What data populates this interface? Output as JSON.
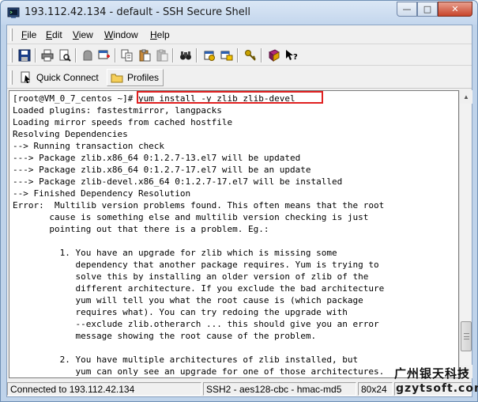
{
  "window": {
    "title": "193.112.42.134 - default - SSH Secure Shell",
    "minimize_label": "—",
    "maximize_label": "□",
    "close_label": "✕"
  },
  "menu": {
    "items": [
      {
        "label": "File",
        "accel": "F",
        "rest": "ile"
      },
      {
        "label": "Edit",
        "accel": "E",
        "rest": "dit"
      },
      {
        "label": "View",
        "accel": "V",
        "rest": "iew"
      },
      {
        "label": "Window",
        "accel": "W",
        "rest": "indow"
      },
      {
        "label": "Help",
        "accel": "H",
        "rest": "elp"
      }
    ]
  },
  "toolbar": {
    "icons": [
      "save-icon",
      "print-icon",
      "print-preview-icon",
      "disconnect-icon",
      "new-window-icon",
      "copy-icon",
      "paste-icon",
      "paste-disabled-icon",
      "find-icon",
      "settings-icon",
      "file-transfer-icon",
      "keys-icon",
      "help-book-icon",
      "whats-this-icon"
    ]
  },
  "quickbar": {
    "quick_connect_label": "Quick Connect",
    "profiles_label": "Profiles"
  },
  "terminal": {
    "prompt": "[root@VM_0_7_centos ~]# ",
    "command": "yum install -y zlib zlib-devel",
    "lines": [
      "Loaded plugins: fastestmirror, langpacks",
      "Loading mirror speeds from cached hostfile",
      "Resolving Dependencies",
      "--> Running transaction check",
      "---> Package zlib.x86_64 0:1.2.7-13.el7 will be updated",
      "---> Package zlib.x86_64 0:1.2.7-17.el7 will be an update",
      "---> Package zlib-devel.x86_64 0:1.2.7-17.el7 will be installed",
      "--> Finished Dependency Resolution",
      "Error:  Multilib version problems found. This often means that the root",
      "       cause is something else and multilib version checking is just",
      "       pointing out that there is a problem. Eg.:",
      "",
      "         1. You have an upgrade for zlib which is missing some",
      "            dependency that another package requires. Yum is trying to",
      "            solve this by installing an older version of zlib of the",
      "            different architecture. If you exclude the bad architecture",
      "            yum will tell you what the root cause is (which package",
      "            requires what). You can try redoing the upgrade with",
      "            --exclude zlib.otherarch ... this should give you an error",
      "            message showing the root cause of the problem.",
      "",
      "         2. You have multiple architectures of zlib installed, but",
      "            yum can only see an upgrade for one of those architectures."
    ]
  },
  "status": {
    "connection": "Connected to 193.112.42.134",
    "cipher": "SSH2 - aes128-cbc - hmac-md5",
    "size": "80x24"
  },
  "watermark": {
    "cn": "广州银天科技",
    "url": "gzytsoft.com"
  },
  "colors": {
    "highlight_box": "#e02020",
    "frame": "#bfd3ea"
  }
}
